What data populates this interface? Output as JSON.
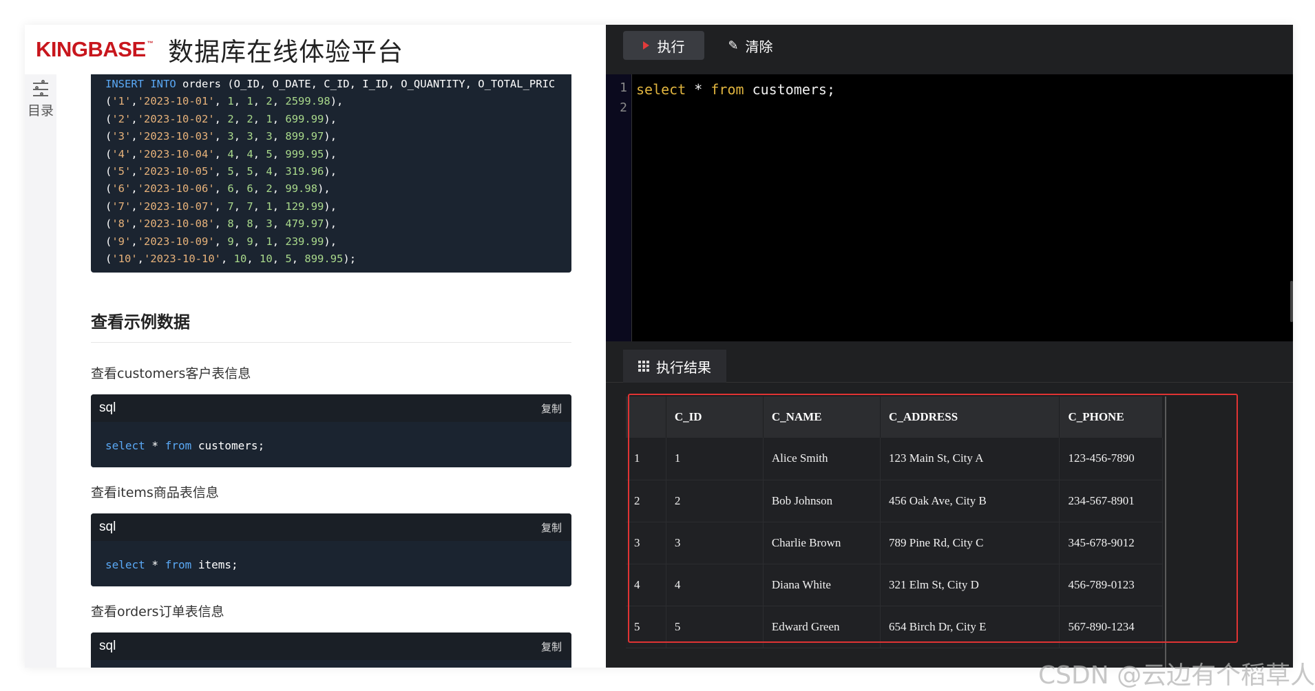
{
  "header": {
    "logo": "KINGBASE",
    "logo_tm": "™",
    "title": "数据库在线体验平台"
  },
  "toc": {
    "label": "目录"
  },
  "insert_code": {
    "lines": [
      [
        {
          "t": "INSERT INTO",
          "c": "kw"
        },
        {
          "t": " orders (O_ID, O_DATE, C_ID, I_ID, O_QUANTITY, O_TOTAL_PRIC",
          "c": "plain"
        }
      ],
      [
        {
          "t": "(",
          "c": "plain"
        },
        {
          "t": "'1'",
          "c": "str"
        },
        {
          "t": ",",
          "c": "plain"
        },
        {
          "t": "'2023-10-01'",
          "c": "str"
        },
        {
          "t": ", ",
          "c": "plain"
        },
        {
          "t": "1",
          "c": "num"
        },
        {
          "t": ", ",
          "c": "plain"
        },
        {
          "t": "1",
          "c": "num"
        },
        {
          "t": ", ",
          "c": "plain"
        },
        {
          "t": "2",
          "c": "num"
        },
        {
          "t": ", ",
          "c": "plain"
        },
        {
          "t": "2599.98",
          "c": "num"
        },
        {
          "t": "),",
          "c": "plain"
        }
      ],
      [
        {
          "t": "(",
          "c": "plain"
        },
        {
          "t": "'2'",
          "c": "str"
        },
        {
          "t": ",",
          "c": "plain"
        },
        {
          "t": "'2023-10-02'",
          "c": "str"
        },
        {
          "t": ", ",
          "c": "plain"
        },
        {
          "t": "2",
          "c": "num"
        },
        {
          "t": ", ",
          "c": "plain"
        },
        {
          "t": "2",
          "c": "num"
        },
        {
          "t": ", ",
          "c": "plain"
        },
        {
          "t": "1",
          "c": "num"
        },
        {
          "t": ", ",
          "c": "plain"
        },
        {
          "t": "699.99",
          "c": "num"
        },
        {
          "t": "),",
          "c": "plain"
        }
      ],
      [
        {
          "t": "(",
          "c": "plain"
        },
        {
          "t": "'3'",
          "c": "str"
        },
        {
          "t": ",",
          "c": "plain"
        },
        {
          "t": "'2023-10-03'",
          "c": "str"
        },
        {
          "t": ", ",
          "c": "plain"
        },
        {
          "t": "3",
          "c": "num"
        },
        {
          "t": ", ",
          "c": "plain"
        },
        {
          "t": "3",
          "c": "num"
        },
        {
          "t": ", ",
          "c": "plain"
        },
        {
          "t": "3",
          "c": "num"
        },
        {
          "t": ", ",
          "c": "plain"
        },
        {
          "t": "899.97",
          "c": "num"
        },
        {
          "t": "),",
          "c": "plain"
        }
      ],
      [
        {
          "t": "(",
          "c": "plain"
        },
        {
          "t": "'4'",
          "c": "str"
        },
        {
          "t": ",",
          "c": "plain"
        },
        {
          "t": "'2023-10-04'",
          "c": "str"
        },
        {
          "t": ", ",
          "c": "plain"
        },
        {
          "t": "4",
          "c": "num"
        },
        {
          "t": ", ",
          "c": "plain"
        },
        {
          "t": "4",
          "c": "num"
        },
        {
          "t": ", ",
          "c": "plain"
        },
        {
          "t": "5",
          "c": "num"
        },
        {
          "t": ", ",
          "c": "plain"
        },
        {
          "t": "999.95",
          "c": "num"
        },
        {
          "t": "),",
          "c": "plain"
        }
      ],
      [
        {
          "t": "(",
          "c": "plain"
        },
        {
          "t": "'5'",
          "c": "str"
        },
        {
          "t": ",",
          "c": "plain"
        },
        {
          "t": "'2023-10-05'",
          "c": "str"
        },
        {
          "t": ", ",
          "c": "plain"
        },
        {
          "t": "5",
          "c": "num"
        },
        {
          "t": ", ",
          "c": "plain"
        },
        {
          "t": "5",
          "c": "num"
        },
        {
          "t": ", ",
          "c": "plain"
        },
        {
          "t": "4",
          "c": "num"
        },
        {
          "t": ", ",
          "c": "plain"
        },
        {
          "t": "319.96",
          "c": "num"
        },
        {
          "t": "),",
          "c": "plain"
        }
      ],
      [
        {
          "t": "(",
          "c": "plain"
        },
        {
          "t": "'6'",
          "c": "str"
        },
        {
          "t": ",",
          "c": "plain"
        },
        {
          "t": "'2023-10-06'",
          "c": "str"
        },
        {
          "t": ", ",
          "c": "plain"
        },
        {
          "t": "6",
          "c": "num"
        },
        {
          "t": ", ",
          "c": "plain"
        },
        {
          "t": "6",
          "c": "num"
        },
        {
          "t": ", ",
          "c": "plain"
        },
        {
          "t": "2",
          "c": "num"
        },
        {
          "t": ", ",
          "c": "plain"
        },
        {
          "t": "99.98",
          "c": "num"
        },
        {
          "t": "),",
          "c": "plain"
        }
      ],
      [
        {
          "t": "(",
          "c": "plain"
        },
        {
          "t": "'7'",
          "c": "str"
        },
        {
          "t": ",",
          "c": "plain"
        },
        {
          "t": "'2023-10-07'",
          "c": "str"
        },
        {
          "t": ", ",
          "c": "plain"
        },
        {
          "t": "7",
          "c": "num"
        },
        {
          "t": ", ",
          "c": "plain"
        },
        {
          "t": "7",
          "c": "num"
        },
        {
          "t": ", ",
          "c": "plain"
        },
        {
          "t": "1",
          "c": "num"
        },
        {
          "t": ", ",
          "c": "plain"
        },
        {
          "t": "129.99",
          "c": "num"
        },
        {
          "t": "),",
          "c": "plain"
        }
      ],
      [
        {
          "t": "(",
          "c": "plain"
        },
        {
          "t": "'8'",
          "c": "str"
        },
        {
          "t": ",",
          "c": "plain"
        },
        {
          "t": "'2023-10-08'",
          "c": "str"
        },
        {
          "t": ", ",
          "c": "plain"
        },
        {
          "t": "8",
          "c": "num"
        },
        {
          "t": ", ",
          "c": "plain"
        },
        {
          "t": "8",
          "c": "num"
        },
        {
          "t": ", ",
          "c": "plain"
        },
        {
          "t": "3",
          "c": "num"
        },
        {
          "t": ", ",
          "c": "plain"
        },
        {
          "t": "479.97",
          "c": "num"
        },
        {
          "t": "),",
          "c": "plain"
        }
      ],
      [
        {
          "t": "(",
          "c": "plain"
        },
        {
          "t": "'9'",
          "c": "str"
        },
        {
          "t": ",",
          "c": "plain"
        },
        {
          "t": "'2023-10-09'",
          "c": "str"
        },
        {
          "t": ", ",
          "c": "plain"
        },
        {
          "t": "9",
          "c": "num"
        },
        {
          "t": ", ",
          "c": "plain"
        },
        {
          "t": "9",
          "c": "num"
        },
        {
          "t": ", ",
          "c": "plain"
        },
        {
          "t": "1",
          "c": "num"
        },
        {
          "t": ", ",
          "c": "plain"
        },
        {
          "t": "239.99",
          "c": "num"
        },
        {
          "t": "),",
          "c": "plain"
        }
      ],
      [
        {
          "t": "(",
          "c": "plain"
        },
        {
          "t": "'10'",
          "c": "str"
        },
        {
          "t": ",",
          "c": "plain"
        },
        {
          "t": "'2023-10-10'",
          "c": "str"
        },
        {
          "t": ", ",
          "c": "plain"
        },
        {
          "t": "10",
          "c": "num"
        },
        {
          "t": ", ",
          "c": "plain"
        },
        {
          "t": "10",
          "c": "num"
        },
        {
          "t": ", ",
          "c": "plain"
        },
        {
          "t": "5",
          "c": "num"
        },
        {
          "t": ", ",
          "c": "plain"
        },
        {
          "t": "899.95",
          "c": "num"
        },
        {
          "t": ");",
          "c": "plain"
        }
      ]
    ]
  },
  "section": {
    "title": "查看示例数据"
  },
  "examples": [
    {
      "desc": "查看customers客户表信息",
      "lang": "sql",
      "copy": "复制",
      "kw1": "select",
      "mid": " * ",
      "kw2": "from",
      "tail": " customers;"
    },
    {
      "desc": "查看items商品表信息",
      "lang": "sql",
      "copy": "复制",
      "kw1": "select",
      "mid": " * ",
      "kw2": "from",
      "tail": " items;"
    },
    {
      "desc": "查看orders订单表信息",
      "lang": "sql",
      "copy": "复制",
      "kw1": "",
      "mid": "",
      "kw2": "",
      "tail": ""
    }
  ],
  "toolbar": {
    "run_label": "执行",
    "clear_label": "清除"
  },
  "editor": {
    "line_numbers": [
      "1",
      "2"
    ],
    "kw1": "select",
    "mid": " * ",
    "kw2": "from",
    "tail": " customers;"
  },
  "results": {
    "tab_label": "执行结果",
    "columns": [
      "",
      "C_ID",
      "C_NAME",
      "C_ADDRESS",
      "C_PHONE"
    ],
    "rows": [
      [
        "1",
        "1",
        "Alice Smith",
        "123 Main St, City A",
        "123-456-7890"
      ],
      [
        "2",
        "2",
        "Bob Johnson",
        "456 Oak Ave, City B",
        "234-567-8901"
      ],
      [
        "3",
        "3",
        "Charlie Brown",
        "789 Pine Rd, City C",
        "345-678-9012"
      ],
      [
        "4",
        "4",
        "Diana White",
        "321 Elm St, City D",
        "456-789-0123"
      ],
      [
        "5",
        "5",
        "Edward Green",
        "654 Birch Dr, City E",
        "567-890-1234"
      ]
    ]
  },
  "watermark": "CSDN @云边有个稻草人",
  "colors": {
    "brand": "#c8161d",
    "highlight": "#e13333",
    "editor_keyword": "#e1b53f"
  }
}
